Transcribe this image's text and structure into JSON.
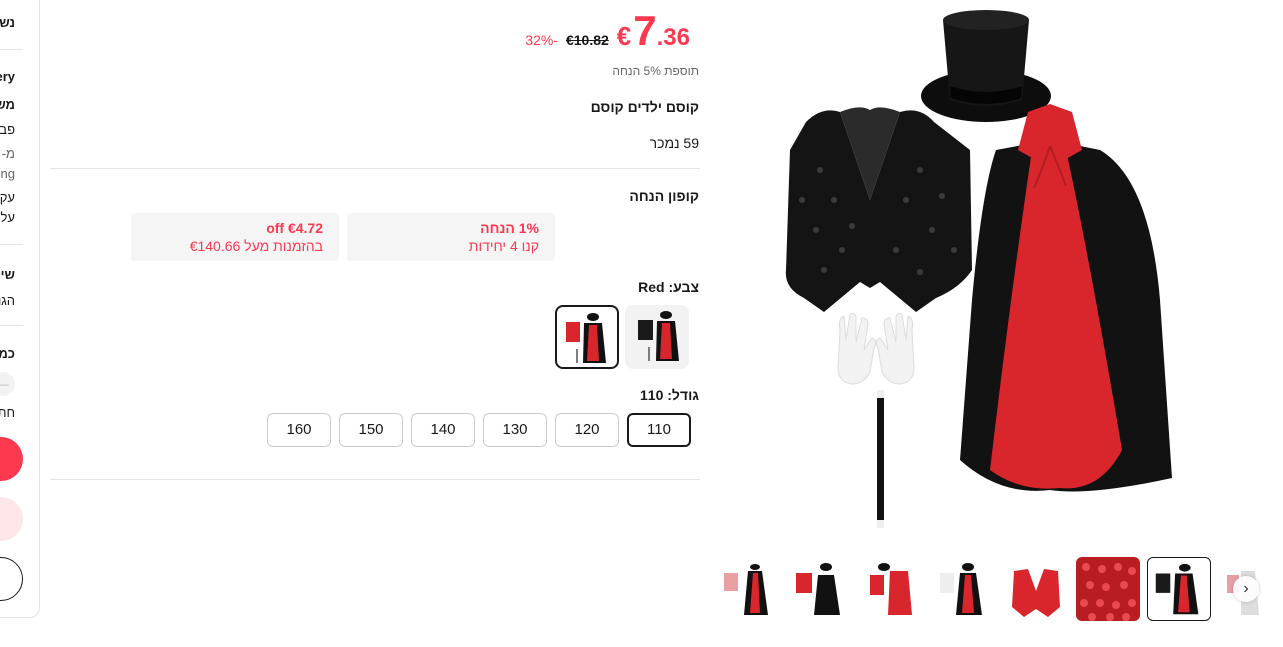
{
  "sidebar": {
    "ship_title": "נש",
    "delivery": "ery",
    "shipping_title": "משי",
    "line1": "פבר",
    "line2": "מ- ב",
    "line3": "ping",
    "line4": "עקב",
    "line5": "על ה",
    "service_title": "שיר",
    "service_line": "הגנו",
    "quantity_title": "כמו",
    "qty_minus": "—",
    "qty_note": "חתיכ"
  },
  "product": {
    "price_currency": "€",
    "price_int": "7",
    "price_dec": ".36",
    "price_old": "€10.82",
    "discount": "32%-",
    "extra_off": "תוספת 5% הנחה",
    "title": "קוסם ילדים קוסם",
    "sold": "59 נמכר"
  },
  "coupons": {
    "title": "קופון הנחה",
    "items": [
      {
        "line1": "1% הנחה",
        "line2": "קנו 4 יחידות"
      },
      {
        "line1": "off €4.72",
        "line2": "בהזמנות מעל €140.66"
      }
    ]
  },
  "color": {
    "label": "צבע: Red",
    "options": [
      {
        "name": "Red",
        "selected": true
      },
      {
        "name": "Black",
        "selected": false
      }
    ]
  },
  "size": {
    "label": "גודל: 110",
    "options": [
      "110",
      "120",
      "130",
      "140",
      "150",
      "160"
    ],
    "selected": "110"
  },
  "gallery": {
    "next_icon": "chevron-right-icon",
    "thumb_count": 8,
    "selected_index": 6
  },
  "colors": {
    "accent": "#fd384f",
    "text": "#191919",
    "muted": "#666666",
    "chip_bg": "#f5f5f5"
  }
}
